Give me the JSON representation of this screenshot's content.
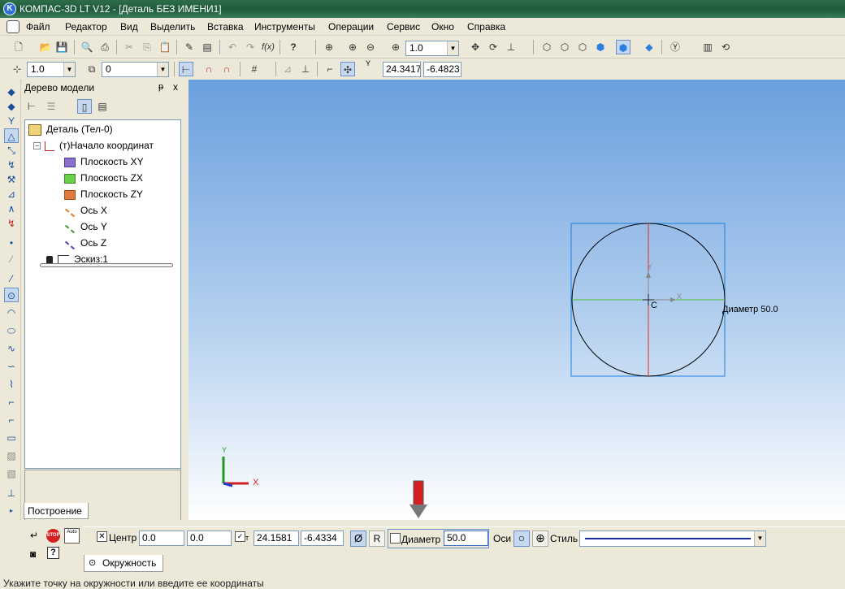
{
  "window": {
    "title": "КОМПАС-3D LT V12 - [Деталь БЕЗ ИМЕНИ1]",
    "app_icon": "kompas-logo-icon"
  },
  "menu": {
    "system_icon": "document-system-icon",
    "items": [
      "Файл",
      "Редактор",
      "Вид",
      "Выделить",
      "Вставка",
      "Инструменты",
      "Операции",
      "Сервис",
      "Окно",
      "Справка"
    ]
  },
  "toolbar_main": {
    "zoom_value": "1.0"
  },
  "toolbar_second": {
    "step_value": "1.0",
    "layer_value": "0",
    "cursor_x": "24.3417",
    "cursor_y": "-6.4823",
    "coord_label": "Y"
  },
  "tree": {
    "title": "Дерево модели",
    "pin": "ᵽ",
    "close": "x",
    "items": [
      "Деталь (Тел-0)",
      "(т)Начало координат",
      "Плоскость XY",
      "Плоскость ZX",
      "Плоскость ZY",
      "Ось X",
      "Ось Y",
      "Ось Z",
      "Эскиз:1"
    ],
    "tab_label": "Построение"
  },
  "sketch": {
    "center_label": "C",
    "axis_x_label": "X",
    "axis_y_label": "Y",
    "dimension_label": "Диаметр 50.0",
    "origin_x_label": "X",
    "origin_y_label": "Y",
    "colors": {
      "circle": "#000000",
      "vertical_line": "#e03020",
      "horizontal_line": "#50c030",
      "bbox": "#1a7fe0",
      "arrow": "#d42020"
    }
  },
  "properties": {
    "center_label": "Центр",
    "center_x": "0.0",
    "center_y": "0.0",
    "point_x": "24.1581",
    "point_y": "-6.4334",
    "diam_symbol": "Ø",
    "radius_symbol": "R",
    "diameter_label": "Диаметр",
    "diameter_value": "50.0",
    "axes_label": "Оси",
    "style_label": "Стиль",
    "stop_label": "STOP",
    "auto_label": "Auto",
    "tab_label": "Окружность"
  },
  "status": {
    "text": "Укажите точку на окружности или введите ее координаты"
  }
}
